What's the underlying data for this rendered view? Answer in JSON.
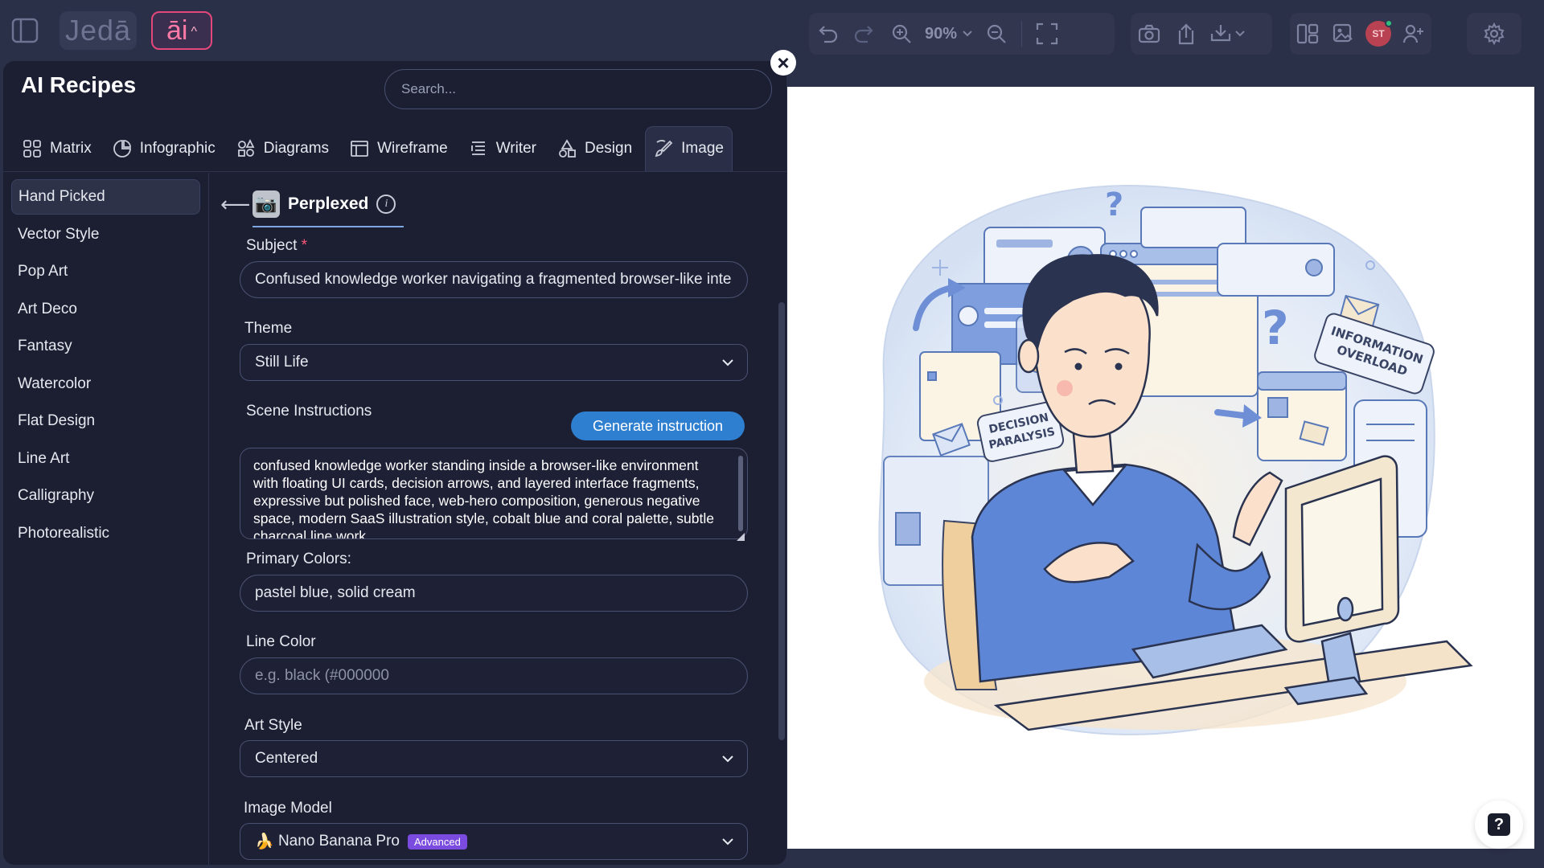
{
  "app": {
    "logo_text": "Jedā",
    "ai_label": "āi"
  },
  "toolbar": {
    "zoom": "90%",
    "avatar_initials": "ST"
  },
  "panel": {
    "title": "AI Recipes",
    "search_placeholder": "Search...",
    "tabs": [
      {
        "label": "Matrix",
        "icon": "grid-icon"
      },
      {
        "label": "Infographic",
        "icon": "pie-chart-icon"
      },
      {
        "label": "Diagrams",
        "icon": "shapes-icon"
      },
      {
        "label": "Wireframe",
        "icon": "wireframe-icon"
      },
      {
        "label": "Writer",
        "icon": "text-lines-icon"
      },
      {
        "label": "Design",
        "icon": "design-shapes-icon"
      },
      {
        "label": "Image",
        "icon": "brush-icon"
      }
    ],
    "active_tab": "Image",
    "categories": [
      "Hand Picked",
      "Vector Style",
      "Pop Art",
      "Art Deco",
      "Fantasy",
      "Watercolor",
      "Flat Design",
      "Line Art",
      "Calligraphy",
      "Photorealistic"
    ],
    "active_category": "Hand Picked"
  },
  "recipe": {
    "name": "Perplexed",
    "subject_label": "Subject",
    "subject_value": "Confused knowledge worker navigating a fragmented browser-like inte",
    "theme_label": "Theme",
    "theme_value": "Still Life",
    "scene_label": "Scene Instructions",
    "generate_label": "Generate instruction",
    "scene_value": "confused knowledge worker standing inside a browser-like environment with floating UI cards, decision arrows, and layered interface fragments, expressive but polished face, web-hero composition, generous negative space, modern SaaS illustration style, cobalt blue and coral palette, subtle charcoal line work",
    "primary_colors_label": "Primary Colors:",
    "primary_colors_value": "pastel blue, solid cream",
    "line_color_label": "Line Color",
    "line_color_placeholder": "e.g. black (#000000",
    "art_style_label": "Art Style",
    "art_style_value": "Centered",
    "image_model_label": "Image Model",
    "image_model_value": "Nano Banana Pro",
    "image_model_badge": "Advanced"
  },
  "illustration": {
    "tag_left": "DECISION PARALYSIS",
    "tag_right": "INFORMATION OVERLOAD",
    "colors": {
      "blue": "#6e8fd6",
      "cream": "#f4e7cf",
      "sweater": "#5e86d6",
      "hair": "#2a3350"
    }
  }
}
